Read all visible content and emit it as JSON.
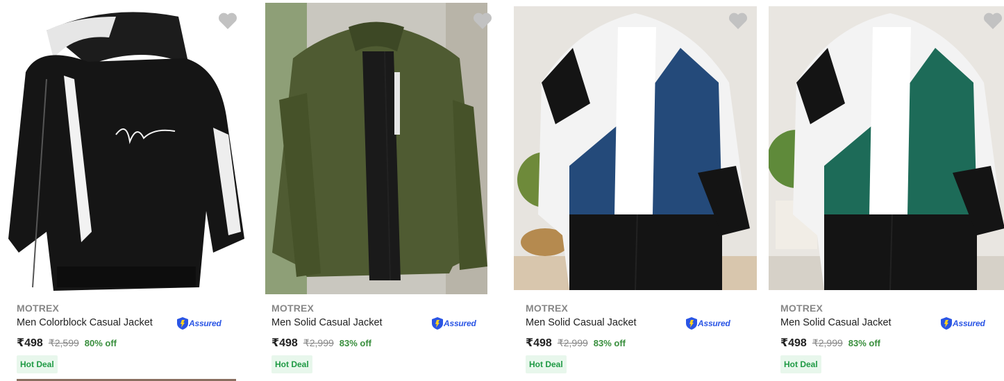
{
  "products": [
    {
      "brand": "MOTREX",
      "title": "Men Colorblock Casual Jacket",
      "assured": "Assured",
      "price": "₹498",
      "mrp": "₹2,599",
      "discount": "80% off",
      "badge": "Hot Deal",
      "image_desc": "black hooded jacket with white sleeve stripes",
      "accent": "#1b1b1b"
    },
    {
      "brand": "MOTREX",
      "title": "Men Solid Casual Jacket",
      "assured": "Assured",
      "price": "₹498",
      "mrp": "₹2,999",
      "discount": "83% off",
      "badge": "Hot Deal",
      "image_desc": "olive green bomber jacket",
      "accent": "#4a5a2e"
    },
    {
      "brand": "MOTREX",
      "title": "Men Solid Casual Jacket",
      "assured": "Assured",
      "price": "₹498",
      "mrp": "₹2,999",
      "discount": "83% off",
      "badge": "Hot Deal",
      "image_desc": "blue white black colorblock jacket",
      "accent": "#244a7a"
    },
    {
      "brand": "MOTREX",
      "title": "Men Solid Casual Jacket",
      "assured": "Assured",
      "price": "₹498",
      "mrp": "₹2,999",
      "discount": "83% off",
      "badge": "Hot Deal",
      "image_desc": "green white black colorblock jacket",
      "accent": "#1d6b58"
    }
  ],
  "icons": {
    "wishlist": "heart-icon",
    "assured": "shield-icon"
  },
  "colors": {
    "discount": "#388e3c",
    "deal_bg": "#e8f7ec",
    "assured": "#2a55e5",
    "wishlist": "#c2c2c2"
  }
}
